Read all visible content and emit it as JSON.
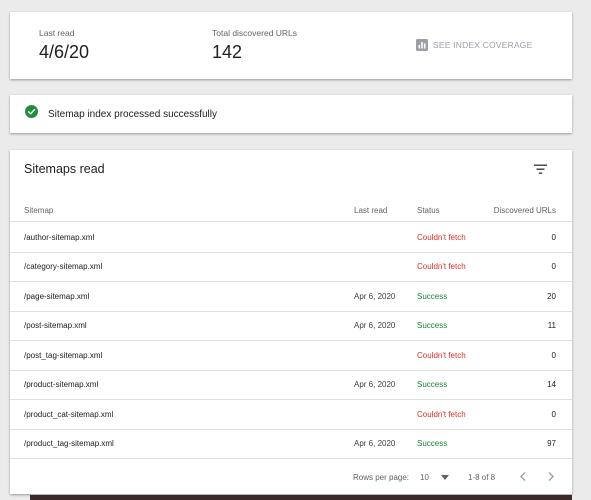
{
  "stats": {
    "last_read_label": "Last read",
    "last_read_value": "4/6/20",
    "total_label": "Total discovered URLs",
    "total_value": "142",
    "coverage_label": "SEE INDEX COVERAGE",
    "coverage_icon": "bar-chart-icon"
  },
  "status": {
    "icon": "check-circle-icon",
    "text": "Sitemap index processed successfully",
    "color": "#1e8e3e"
  },
  "table": {
    "title": "Sitemaps read",
    "filter_icon": "filter-icon",
    "headers": {
      "sitemap": "Sitemap",
      "last_read": "Last read",
      "status": "Status",
      "discovered": "Discovered URLs"
    },
    "rows": [
      {
        "sitemap": "/author-sitemap.xml",
        "last_read": "",
        "status": "Couldn't fetch",
        "urls": "0"
      },
      {
        "sitemap": "/category-sitemap.xml",
        "last_read": "",
        "status": "Couldn't fetch",
        "urls": "0"
      },
      {
        "sitemap": "/page-sitemap.xml",
        "last_read": "Apr 6, 2020",
        "status": "Success",
        "urls": "20"
      },
      {
        "sitemap": "/post-sitemap.xml",
        "last_read": "Apr 6, 2020",
        "status": "Success",
        "urls": "11"
      },
      {
        "sitemap": "/post_tag-sitemap.xml",
        "last_read": "",
        "status": "Couldn't fetch",
        "urls": "0"
      },
      {
        "sitemap": "/product-sitemap.xml",
        "last_read": "Apr 6, 2020",
        "status": "Success",
        "urls": "14"
      },
      {
        "sitemap": "/product_cat-sitemap.xml",
        "last_read": "",
        "status": "Couldn't fetch",
        "urls": "0"
      },
      {
        "sitemap": "/product_tag-sitemap.xml",
        "last_read": "Apr 6, 2020",
        "status": "Success",
        "urls": "97"
      }
    ],
    "status_colors": {
      "Success": "#188038",
      "Couldn't fetch": "#d93025"
    }
  },
  "pagination": {
    "rows_per_page_label": "Rows per page:",
    "rows_per_page_value": "10",
    "range": "1-8 of 8",
    "prev_icon": "chevron-left-icon",
    "next_icon": "chevron-right-icon"
  }
}
